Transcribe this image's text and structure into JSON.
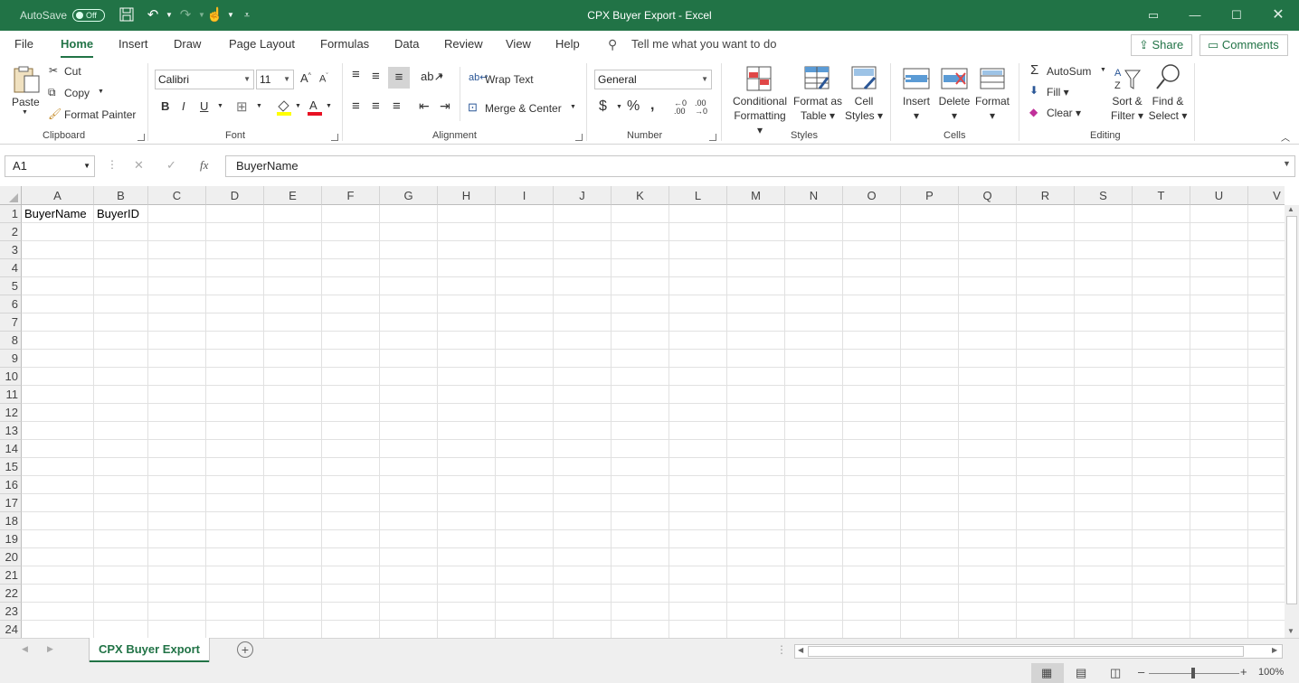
{
  "window": {
    "title": "CPX Buyer Export  -  Excel",
    "autosave_label": "AutoSave",
    "autosave_state": "Off"
  },
  "menu": {
    "tabs": [
      "File",
      "Home",
      "Insert",
      "Draw",
      "Page Layout",
      "Formulas",
      "Data",
      "Review",
      "View",
      "Help"
    ],
    "tell_me": "Tell me what you want to do",
    "share": "Share",
    "comments": "Comments"
  },
  "ribbon": {
    "clipboard": {
      "paste": "Paste",
      "cut": "Cut",
      "copy": "Copy",
      "format_painter": "Format Painter",
      "label": "Clipboard"
    },
    "font": {
      "name": "Calibri",
      "size": "11",
      "bold": "B",
      "italic": "I",
      "underline": "U",
      "label": "Font"
    },
    "alignment": {
      "wrap": "Wrap Text",
      "merge": "Merge & Center",
      "label": "Alignment"
    },
    "number": {
      "format": "General",
      "label": "Number"
    },
    "styles": {
      "conditional": "Conditional",
      "conditional2": "Formatting",
      "format_table": "Format as",
      "format_table2": "Table",
      "cell_styles": "Cell",
      "cell_styles2": "Styles",
      "label": "Styles"
    },
    "cells": {
      "insert": "Insert",
      "delete": "Delete",
      "format": "Format",
      "label": "Cells"
    },
    "editing": {
      "autosum": "AutoSum",
      "fill": "Fill",
      "clear": "Clear",
      "sort": "Sort &",
      "sort2": "Filter",
      "find": "Find &",
      "find2": "Select",
      "label": "Editing"
    }
  },
  "formula_bar": {
    "name_box": "A1",
    "fx": "fx",
    "content": "BuyerName"
  },
  "grid": {
    "columns": [
      "A",
      "B",
      "C",
      "D",
      "E",
      "F",
      "G",
      "H",
      "I",
      "J",
      "K",
      "L",
      "M",
      "N",
      "O",
      "P",
      "Q",
      "R",
      "S",
      "T",
      "U",
      "V"
    ],
    "rows": [
      "1",
      "2",
      "3",
      "4",
      "5",
      "6",
      "7",
      "8",
      "9",
      "10",
      "11",
      "12",
      "13",
      "14",
      "15",
      "16",
      "17",
      "18",
      "19",
      "20",
      "21",
      "22",
      "23",
      "24"
    ],
    "cells": {
      "A1": "BuyerName",
      "B1": "BuyerID"
    }
  },
  "sheets": {
    "active": "CPX Buyer Export"
  },
  "status": {
    "zoom": "100%"
  },
  "colors": {
    "accent": "#217346",
    "font_red": "#e81123",
    "highlight_yellow": "#ffff00"
  }
}
